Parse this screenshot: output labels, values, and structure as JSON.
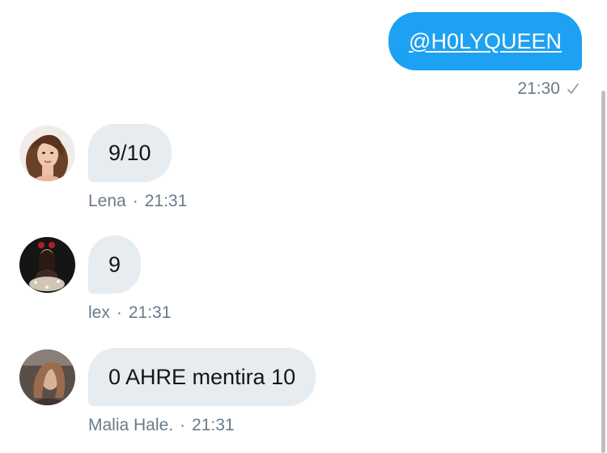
{
  "sent": {
    "mention": "@H0LYQUEEN",
    "time": "21:30",
    "status_icon": "check-icon"
  },
  "messages": [
    {
      "text": "9/10",
      "author": "Lena",
      "time": "21:31",
      "avatar": "avatar-photo"
    },
    {
      "text": "9",
      "author": "lex",
      "time": "21:31",
      "avatar": "avatar-photo"
    },
    {
      "text": "0 AHRE mentira 10",
      "author": "Malia Hale.",
      "time": "21:31",
      "avatar": "avatar-photo"
    }
  ],
  "separator": "·",
  "colors": {
    "sent_bubble": "#1da1f2",
    "received_bubble": "#e6ecf0",
    "meta_text": "#687b89"
  }
}
